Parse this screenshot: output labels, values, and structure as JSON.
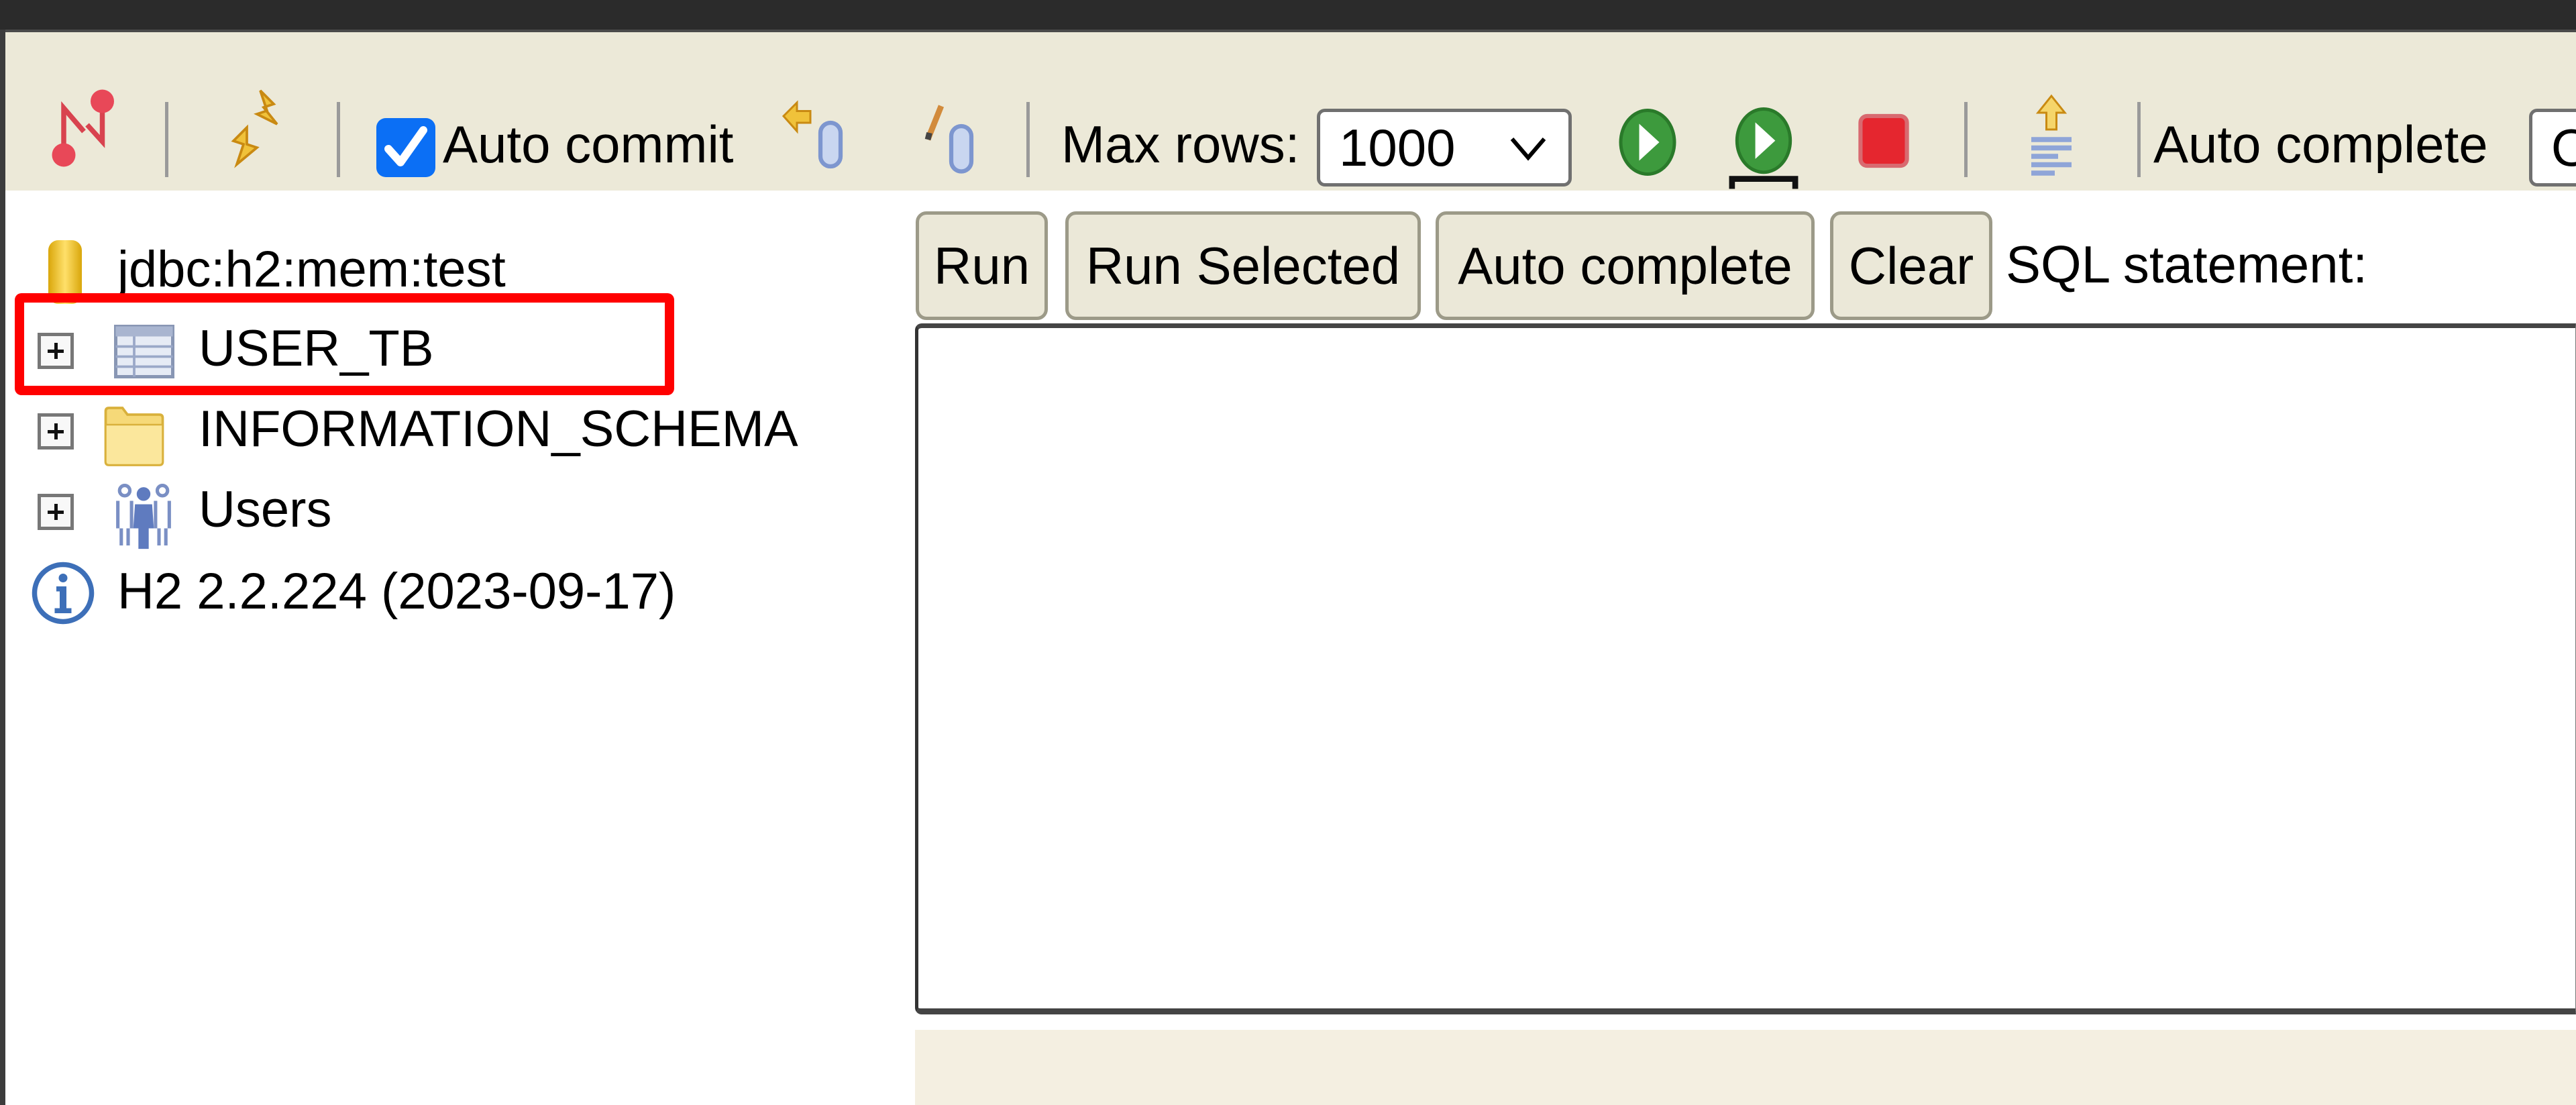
{
  "toolbar": {
    "disconnect_icon": "disconnect-icon",
    "refresh_icon": "refresh-icon",
    "auto_commit_label": "Auto commit",
    "auto_commit_checked": true,
    "rollback_icon": "rollback-icon",
    "commit_icon": "commit-icon",
    "max_rows_label": "Max rows:",
    "max_rows_value": "1000",
    "run_icon": "run-icon",
    "run_selected_icon": "run-selected-icon",
    "stop_icon": "stop-icon",
    "history_icon": "history-icon",
    "auto_complete_label": "Auto complete",
    "auto_complete_value": "Off"
  },
  "tree": {
    "connection": {
      "label": "jdbc:h2:mem:test",
      "icon": "database-icon"
    },
    "items": [
      {
        "label": "USER_TB",
        "icon": "table-icon",
        "expandable": true,
        "highlighted": true
      },
      {
        "label": "INFORMATION_SCHEMA",
        "icon": "folder-icon",
        "expandable": true
      },
      {
        "label": "Users",
        "icon": "users-icon",
        "expandable": true
      }
    ],
    "version": {
      "label": "H2 2.2.224 (2023-09-17)",
      "icon": "info-icon"
    }
  },
  "query": {
    "buttons": [
      {
        "label": "Run"
      },
      {
        "label": "Run Selected"
      },
      {
        "label": "Auto complete"
      },
      {
        "label": "Clear"
      }
    ],
    "sql_label": "SQL statement:",
    "sql_value": ""
  },
  "colors": {
    "toolbar_bg": "#ece9d8",
    "highlight": "#ff0000",
    "checkbox": "#0b6ff5",
    "result_bg": "#f4efe1"
  }
}
